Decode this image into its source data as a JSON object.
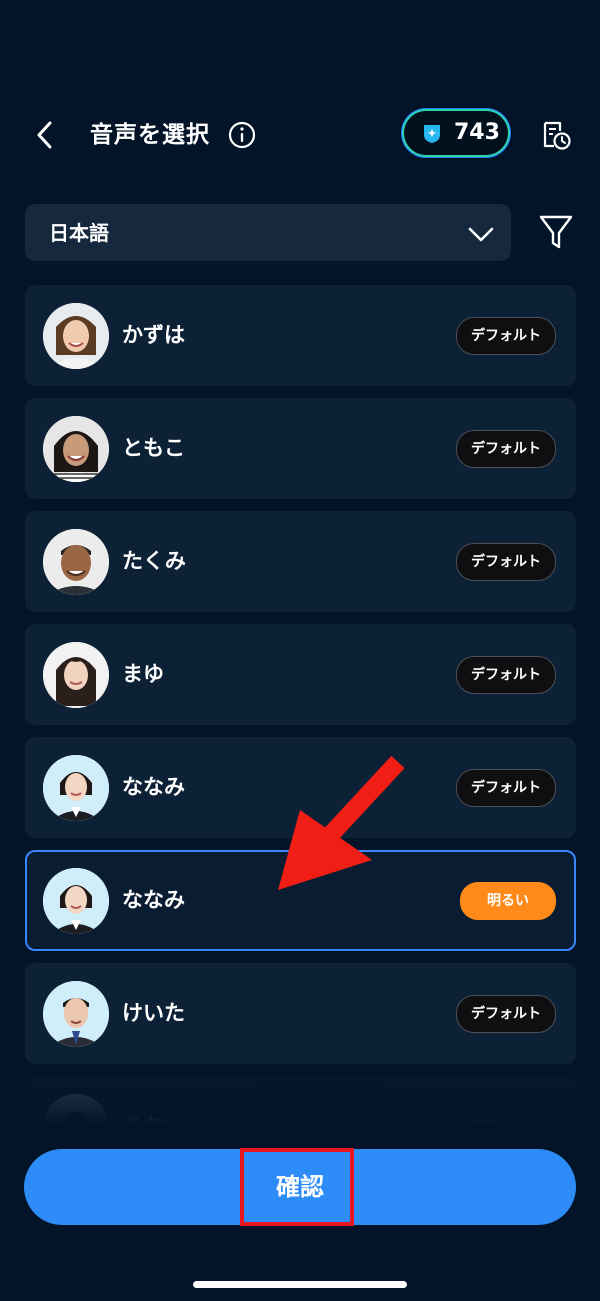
{
  "header": {
    "title": "音声を選択",
    "credits": "743"
  },
  "language_select": {
    "value": "日本語"
  },
  "voices": [
    {
      "name": "かずは",
      "tag": "デフォルト"
    },
    {
      "name": "ともこ",
      "tag": "デフォルト"
    },
    {
      "name": "たくみ",
      "tag": "デフォルト"
    },
    {
      "name": "まゆ",
      "tag": "デフォルト"
    },
    {
      "name": "ななみ",
      "tag": "デフォルト"
    },
    {
      "name": "ななみ",
      "tag": "明るい",
      "selected": true
    },
    {
      "name": "けいた",
      "tag": "デフォルト"
    },
    {
      "name": "あおい",
      "tag": "デフォルト"
    }
  ],
  "confirm": {
    "label": "確認"
  },
  "colors": {
    "background": "#031428",
    "card": "#0d2136",
    "accent_blue": "#2e8cf8",
    "tag_orange": "#ff8a1a",
    "annotation_red": "#e8171f"
  },
  "icons": [
    "back-chevron-icon",
    "info-icon",
    "gem-icon",
    "history-icon",
    "chevron-down-icon",
    "filter-icon"
  ]
}
